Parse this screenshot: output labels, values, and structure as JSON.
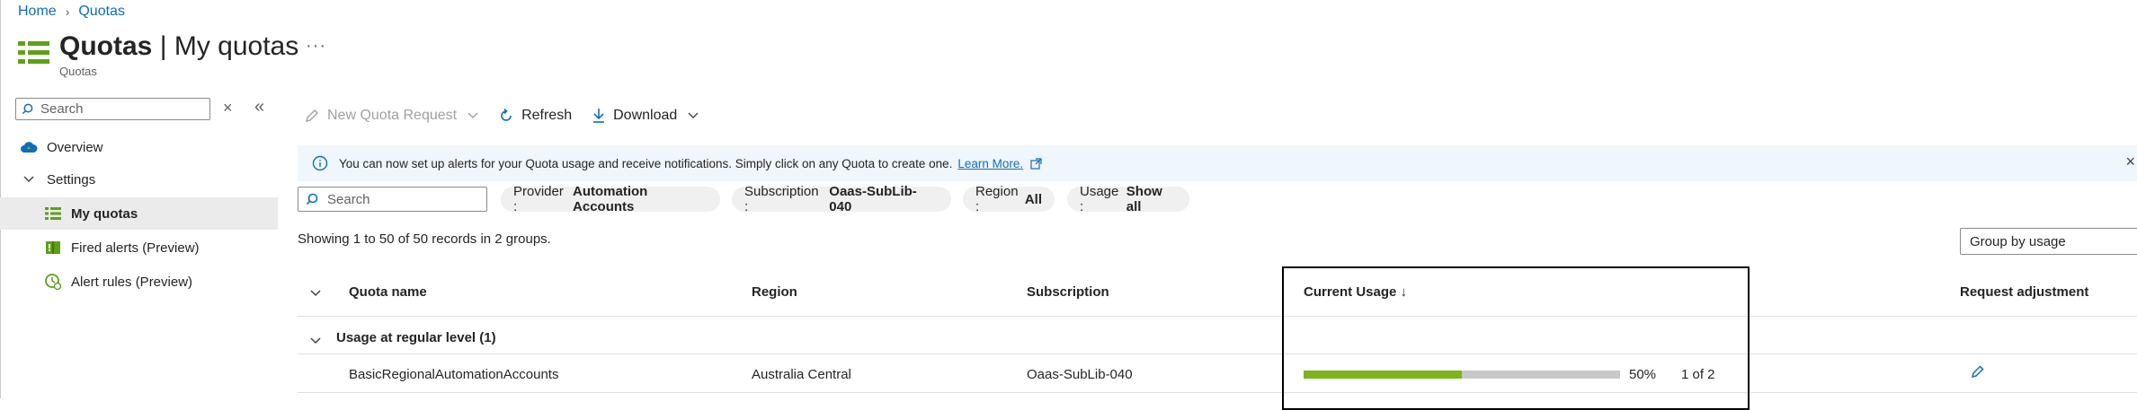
{
  "breadcrumb": {
    "home": "Home",
    "sep": ">",
    "quotas": "Quotas"
  },
  "header": {
    "title_strong": "Quotas",
    "title_sep": " | ",
    "title_rest": "My quotas",
    "subtitle": "Quotas",
    "more": "···"
  },
  "sidebar": {
    "search_placeholder": "Search",
    "items": [
      {
        "label": "Overview",
        "icon": "cloud-icon"
      },
      {
        "label": "Settings",
        "icon": "chevron-down-icon"
      },
      {
        "label": "My quotas",
        "icon": "list-icon",
        "selected": true
      },
      {
        "label": "Fired alerts (Preview)",
        "icon": "alert-book-icon"
      },
      {
        "label": "Alert rules (Preview)",
        "icon": "alert-clock-icon"
      }
    ]
  },
  "toolbar": {
    "new_request": "New Quota Request",
    "refresh": "Refresh",
    "download": "Download"
  },
  "info": {
    "text": "You can now set up alerts for your Quota usage and receive notifications. Simply click on any Quota to create one.",
    "link": "Learn More."
  },
  "filters": {
    "search_placeholder": "Search",
    "provider_key": "Provider :",
    "provider_val": "Automation Accounts",
    "subscription_key": "Subscription :",
    "subscription_val": "Oaas-SubLib-040",
    "region_key": "Region :",
    "region_val": "All",
    "usage_key": "Usage :",
    "usage_val": "Show all"
  },
  "records_text": "Showing 1 to 50 of 50 records in 2 groups.",
  "group_by": "Group by usage",
  "table": {
    "headers": {
      "name": "Quota name",
      "region": "Region",
      "subscription": "Subscription",
      "usage": "Current Usage ↓",
      "adjust": "Request adjustment"
    },
    "group_label": "Usage at regular level (1)",
    "rows": [
      {
        "name": "BasicRegionalAutomationAccounts",
        "region": "Australia Central",
        "subscription": "Oaas-SubLib-040",
        "usage_percent": 50,
        "usage_percent_label": "50%",
        "usage_count": "1 of 2"
      }
    ]
  },
  "colors": {
    "accent": "#0f6cbd",
    "usage_bar": "#7cb518",
    "info_bg": "#eff6fc"
  }
}
